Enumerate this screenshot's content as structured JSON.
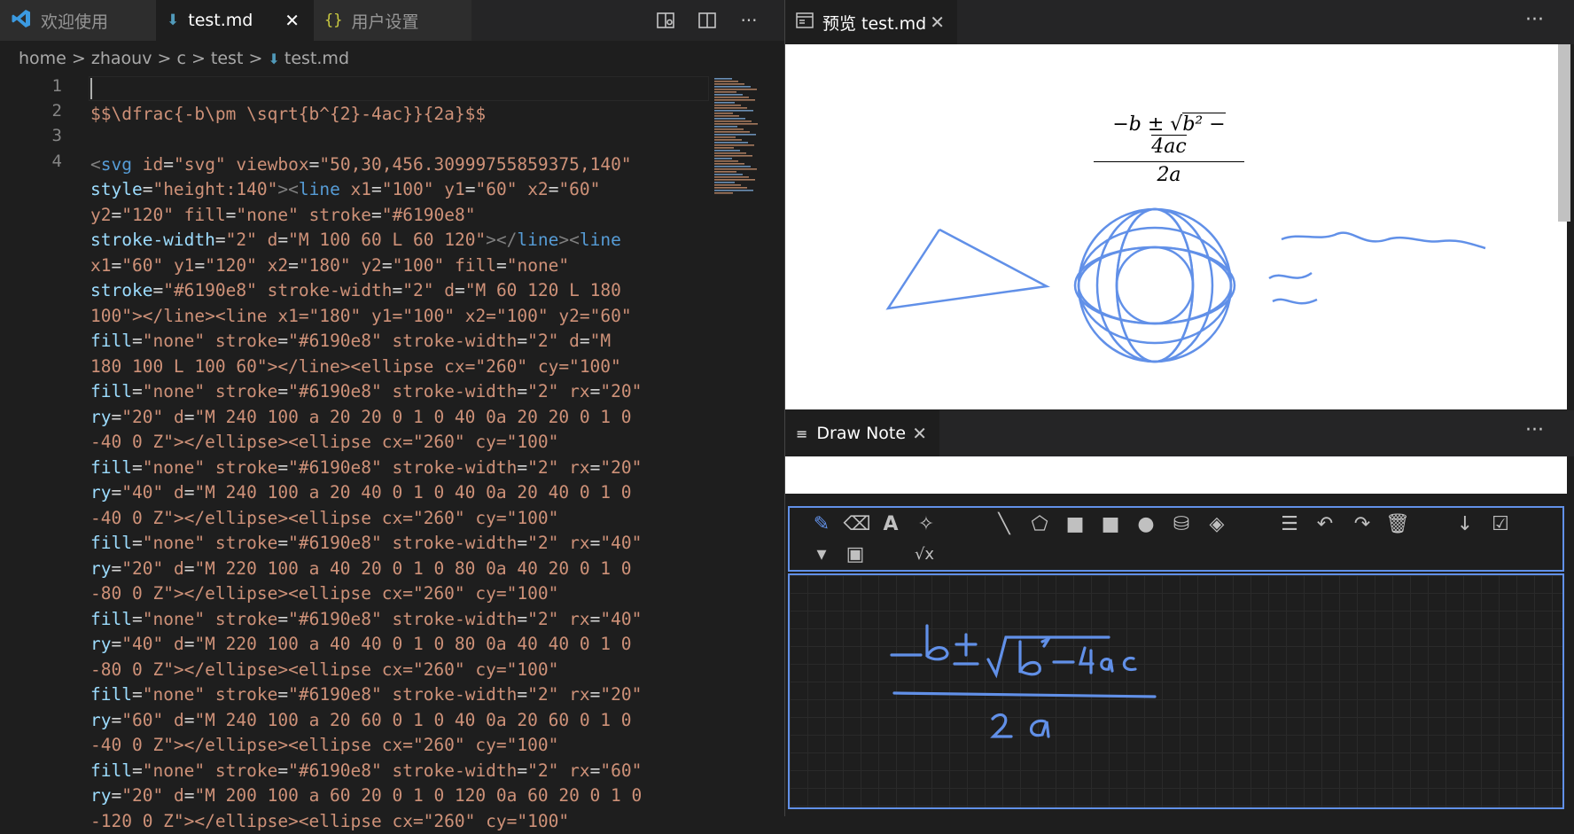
{
  "left_tabs": [
    {
      "label": "欢迎使用",
      "icon": "vscode-logo-icon"
    },
    {
      "label": "test.md",
      "icon": "markdown-file-icon",
      "active": true
    },
    {
      "label": "用户设置",
      "icon": "json-braces-icon"
    }
  ],
  "left_actions": [
    "open-preview-side-icon",
    "split-editor-icon",
    "more-actions-icon"
  ],
  "breadcrumb": [
    "home",
    "zhaouv",
    "c",
    "test",
    "test.md"
  ],
  "line_numbers": [
    "1",
    "2",
    "3",
    "4"
  ],
  "code": {
    "line2": "$$\\dfrac{-b\\pm \\sqrt{b^{2}-4ac}}{2a}$$",
    "svg_lines": [
      "<svg id=\"svg\" viewbox=\"50,30,456.30999755859375,140\"",
      "style=\"height:140\"><line x1=\"100\" y1=\"60\" x2=\"60\"",
      "y2=\"120\" fill=\"none\" stroke=\"#6190e8\"",
      "stroke-width=\"2\" d=\"M 100 60 L 60 120\"></line><line",
      "x1=\"60\" y1=\"120\" x2=\"180\" y2=\"100\" fill=\"none\"",
      "stroke=\"#6190e8\" stroke-width=\"2\" d=\"M 60 120 L 180",
      "100\"></line><line x1=\"180\" y1=\"100\" x2=\"100\" y2=\"60\"",
      "fill=\"none\" stroke=\"#6190e8\" stroke-width=\"2\" d=\"M",
      "180 100 L 100 60\"></line><ellipse cx=\"260\" cy=\"100\"",
      "fill=\"none\" stroke=\"#6190e8\" stroke-width=\"2\" rx=\"20\"",
      "ry=\"20\" d=\"M 240 100 a 20 20 0 1 0 40 0a 20 20 0 1 0",
      "-40 0 Z\"></ellipse><ellipse cx=\"260\" cy=\"100\"",
      "fill=\"none\" stroke=\"#6190e8\" stroke-width=\"2\" rx=\"20\"",
      "ry=\"40\" d=\"M 240 100 a 20 40 0 1 0 40 0a 20 40 0 1 0",
      "-40 0 Z\"></ellipse><ellipse cx=\"260\" cy=\"100\"",
      "fill=\"none\" stroke=\"#6190e8\" stroke-width=\"2\" rx=\"40\"",
      "ry=\"20\" d=\"M 220 100 a 40 20 0 1 0 80 0a 40 20 0 1 0",
      "-80 0 Z\"></ellipse><ellipse cx=\"260\" cy=\"100\"",
      "fill=\"none\" stroke=\"#6190e8\" stroke-width=\"2\" rx=\"40\"",
      "ry=\"40\" d=\"M 220 100 a 40 40 0 1 0 80 0a 40 40 0 1 0",
      "-80 0 Z\"></ellipse><ellipse cx=\"260\" cy=\"100\"",
      "fill=\"none\" stroke=\"#6190e8\" stroke-width=\"2\" rx=\"20\"",
      "ry=\"60\" d=\"M 240 100 a 20 60 0 1 0 40 0a 20 60 0 1 0",
      "-40 0 Z\"></ellipse><ellipse cx=\"260\" cy=\"100\"",
      "fill=\"none\" stroke=\"#6190e8\" stroke-width=\"2\" rx=\"60\"",
      "ry=\"20\" d=\"M 200 100 a 60 20 0 1 0 120 0a 60 20 0 1 0",
      "-120 0 Z\"></ellipse><ellipse cx=\"260\" cy=\"100\""
    ]
  },
  "preview": {
    "tab_label": "预览 test.md",
    "math": {
      "minus_b": "−b ±",
      "radicand": "b² − 4ac",
      "denominator": "2a"
    }
  },
  "draw_note": {
    "tab_label": "Draw Note",
    "tools": [
      "pencil-icon",
      "eraser-icon",
      "text-icon",
      "magic-wand-icon",
      "line-icon",
      "polygon-icon",
      "rectangle-icon",
      "filled-rectangle-icon",
      "circle-icon",
      "cylinder-icon",
      "layers-icon",
      "sliders-icon",
      "undo-icon",
      "redo-icon",
      "trash-icon",
      "download-icon",
      "checkbox-icon",
      "collapse-icon",
      "record-icon",
      "sqrt-x-icon"
    ]
  },
  "colors": {
    "accent": "#6190e8",
    "editor_bg": "#1e1e1e",
    "tab_bar": "#252526"
  }
}
